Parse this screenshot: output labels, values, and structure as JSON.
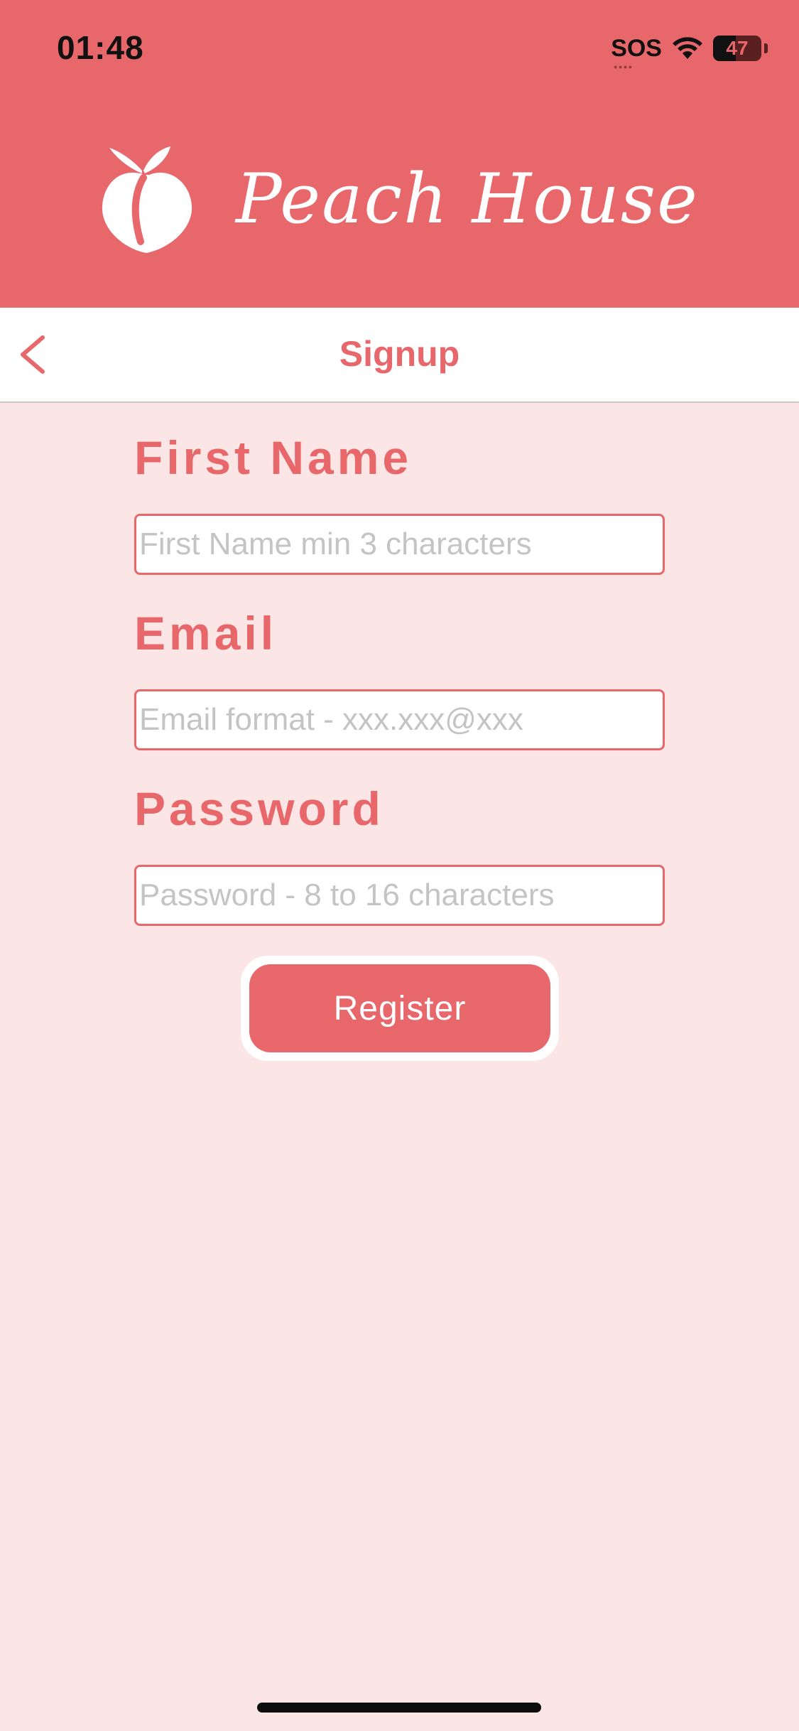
{
  "status_bar": {
    "time": "01:48",
    "sos": "SOS",
    "sos_dots": "••••",
    "battery_percent": "47",
    "battery_level": 0.47
  },
  "header": {
    "brand_name": "Peach House",
    "logo_icon": "peach-icon",
    "background_color": "#e8676b"
  },
  "navbar": {
    "title": "Signup",
    "back_icon": "chevron-left-icon"
  },
  "form": {
    "first_name": {
      "label": "First Name",
      "value": "",
      "placeholder": "First Name min 3 characters"
    },
    "email": {
      "label": "Email",
      "value": "",
      "placeholder": "Email format - xxx.xxx@xxx"
    },
    "password": {
      "label": "Password",
      "value": "",
      "placeholder": "Password - 8 to 16 characters"
    },
    "register_label": "Register"
  },
  "colors": {
    "accent": "#e8676b",
    "background": "#fbe6e5",
    "placeholder": "#c4c4c4"
  }
}
